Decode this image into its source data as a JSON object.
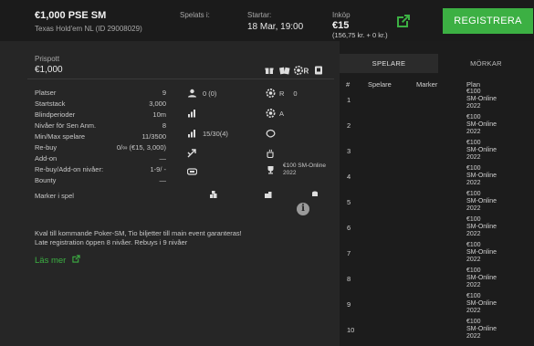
{
  "header": {
    "title": "€1,000 PSE SM",
    "subtitle": "Texas Hold'em NL (ID 29008029)",
    "played_label": "Spelats i:",
    "starts_label": "Startar:",
    "starts_value": "18 Mar, 19:00",
    "buyin_label": "Inköp",
    "buyin_value": "€15",
    "buyin_detail": "(156,75 kr. + 0 kr.)",
    "register_label": "REGISTRERA",
    "accent_color": "#3cb043"
  },
  "prize": {
    "label": "Prispott",
    "value": "€1,000",
    "badges": [
      "gift-icon",
      "tickets-icon",
      "chip-r-icon",
      "q-icon"
    ]
  },
  "info": [
    {
      "key": "Platser",
      "value": "9"
    },
    {
      "key": "Startstack",
      "value": "3,000"
    },
    {
      "key": "Blindperioder",
      "value": "10m"
    },
    {
      "key": "Nivåer för Sen Anm.",
      "value": "8"
    },
    {
      "key": "Min/Max spelare",
      "value": "11/3500"
    },
    {
      "key": "Re-buy",
      "value": "0/∞ (€15, 3,000)"
    },
    {
      "key": "Add-on",
      "value": "—"
    },
    {
      "key": "Re-buy/Add-on nivåer:",
      "value": "1-9/ -"
    },
    {
      "key": "Bounty",
      "value": "—"
    }
  ],
  "mid": {
    "players": "0 (0)",
    "tables": "15/30(4)"
  },
  "right": {
    "rebuy": "R",
    "rebuy_count": "0",
    "addon": "A",
    "prize_line1": "€100 SM-Online",
    "prize_line2": "2022"
  },
  "markers_label": "Marker i spel",
  "description": {
    "line1": "Kval till kommande Poker-SM, Tio biljetter till main event garanteras!",
    "line2": "Late registration öppen 8 nivåer. Rebuys i 9 nivåer"
  },
  "read_more": "Läs mer",
  "panel": {
    "tab_players": "SPELARE",
    "tab_markers": "MÖRKAR",
    "col_num": "#",
    "col_player": "Spelare",
    "col_marker": "Marker",
    "col_plan": "Plan",
    "rows": [
      {
        "num": "1",
        "plan": [
          "€100",
          "SM-Online",
          "2022"
        ]
      },
      {
        "num": "2",
        "plan": [
          "€100",
          "SM-Online",
          "2022"
        ]
      },
      {
        "num": "3",
        "plan": [
          "€100",
          "SM-Online",
          "2022"
        ]
      },
      {
        "num": "4",
        "plan": [
          "€100",
          "SM-Online",
          "2022"
        ]
      },
      {
        "num": "5",
        "plan": [
          "€100",
          "SM-Online",
          "2022"
        ]
      },
      {
        "num": "6",
        "plan": [
          "€100",
          "SM-Online",
          "2022"
        ]
      },
      {
        "num": "7",
        "plan": [
          "€100",
          "SM-Online",
          "2022"
        ]
      },
      {
        "num": "8",
        "plan": [
          "€100",
          "SM-Online",
          "2022"
        ]
      },
      {
        "num": "9",
        "plan": [
          "€100",
          "SM-Online",
          "2022"
        ]
      },
      {
        "num": "10",
        "plan": [
          "€100",
          "SM-Online",
          "2022"
        ]
      }
    ]
  }
}
